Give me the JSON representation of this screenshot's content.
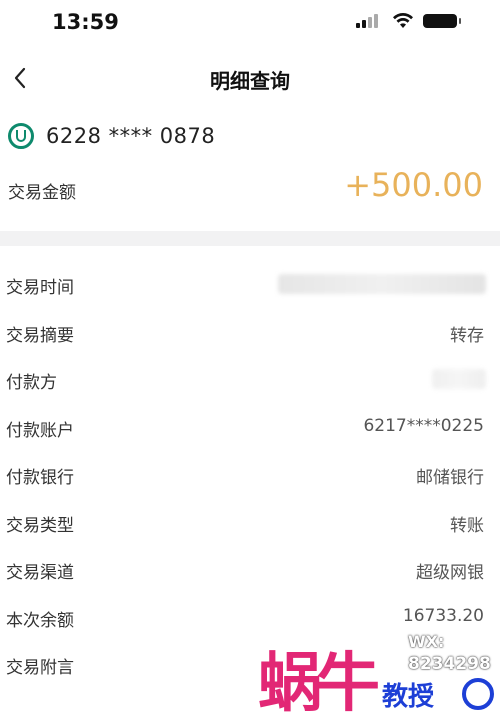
{
  "status_bar": {
    "time": "13:59"
  },
  "nav": {
    "title": "明细查询",
    "back_icon": "chevron-left-icon"
  },
  "account": {
    "logo_icon": "bank-logo-icon",
    "card_number": "6228 **** 0878",
    "amount_label": "交易金额",
    "amount_value": "+500.00"
  },
  "details": [
    {
      "label": "交易时间",
      "value": ""
    },
    {
      "label": "交易摘要",
      "value": "转存"
    },
    {
      "label": "付款方",
      "value": ""
    },
    {
      "label": "付款账户",
      "value": "6217****0225"
    },
    {
      "label": "付款银行",
      "value": "邮储银行"
    },
    {
      "label": "交易类型",
      "value": "转账"
    },
    {
      "label": "交易渠道",
      "value": "超级网银"
    },
    {
      "label": "本次余额",
      "value": "16733.20"
    },
    {
      "label": "交易附言",
      "value": ""
    }
  ],
  "watermark": {
    "big_text": "蜗牛",
    "wx_label": "WX:",
    "wx_number": "8234298",
    "small_text": "教授"
  },
  "colors": {
    "amount": "#e8b25a",
    "bank_green": "#0e8a6d",
    "watermark_pink": "#e0156a",
    "watermark_blue": "#1d3fd6"
  }
}
